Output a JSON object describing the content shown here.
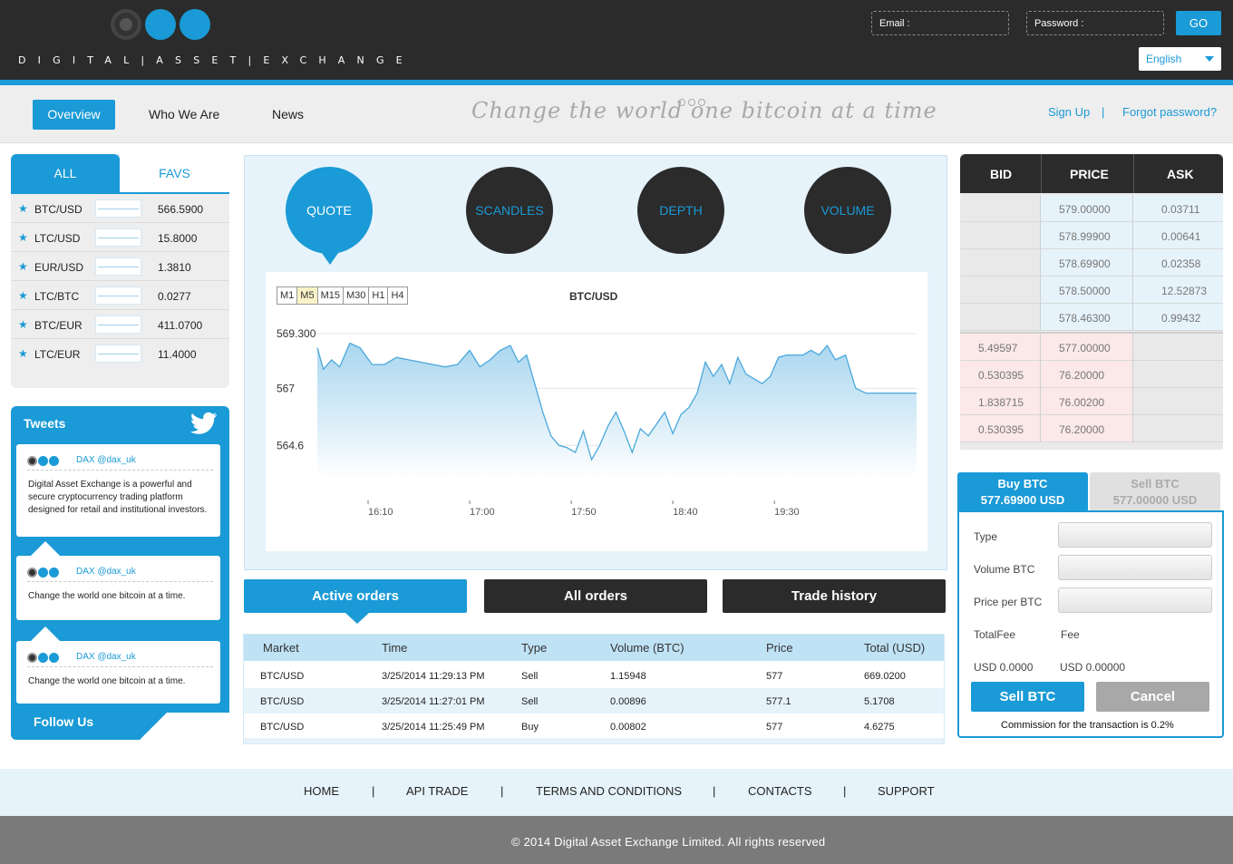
{
  "header": {
    "logo_text": "DIGITAL|ASSET|EXCHANGE",
    "email_placeholder": "Email :",
    "password_placeholder": "Password :",
    "go_label": "GO",
    "language": "English"
  },
  "nav": {
    "items": [
      {
        "label": "Overview"
      },
      {
        "label": "Who We Are"
      },
      {
        "label": "News"
      }
    ],
    "slogan": "Change the world one bitcoin at a time",
    "sign_up": "Sign Up",
    "separator": "|",
    "forgot_password": "Forgot password?"
  },
  "markets": {
    "tabs": [
      "ALL",
      "FAVS"
    ],
    "rows": [
      {
        "pair": "BTC/USD",
        "price": "566.5900"
      },
      {
        "pair": "LTC/USD",
        "price": "15.8000"
      },
      {
        "pair": "EUR/USD",
        "price": "1.3810"
      },
      {
        "pair": "LTC/BTC",
        "price": "0.0277"
      },
      {
        "pair": "BTC/EUR",
        "price": "411.0700"
      },
      {
        "pair": "LTC/EUR",
        "price": "11.4000"
      }
    ]
  },
  "tweets": {
    "title": "Tweets",
    "items": [
      {
        "handle": "DAX @dax_uk",
        "text": "Digital Asset Exchange is a powerful and secure cryptocurrency trading platform designed for retail and institutional investors."
      },
      {
        "handle": "DAX @dax_uk",
        "text": "Change the world one bitcoin at a time."
      },
      {
        "handle": "DAX @dax_uk",
        "text": "Change the world one bitcoin at a time."
      }
    ],
    "follow_us": "Follow Us"
  },
  "chart_panel": {
    "buttons": [
      "QUOTE",
      "SCANDLES",
      "DEPTH",
      "VOLUME"
    ],
    "timeframes": [
      "M1",
      "M5",
      "M15",
      "M30",
      "H1",
      "H4"
    ],
    "active_timeframe": "M5"
  },
  "chart_data": {
    "type": "area",
    "title": "BTC/USD",
    "xlabel": "",
    "ylabel": "",
    "ytick_labels": [
      "569.300",
      "567",
      "564.6"
    ],
    "ylim": [
      563.2,
      569.3
    ],
    "xtick_labels": [
      "16:10",
      "17:00",
      "17:50",
      "18:40",
      "19:30"
    ],
    "x": [
      "15:45",
      "15:48",
      "15:52",
      "15:56",
      "16:01",
      "16:06",
      "16:12",
      "16:18",
      "16:24",
      "16:30",
      "16:36",
      "16:42",
      "16:48",
      "16:54",
      "17:00",
      "17:05",
      "17:10",
      "17:15",
      "17:20",
      "17:24",
      "17:28",
      "17:32",
      "17:36",
      "17:40",
      "17:44",
      "17:48",
      "17:52",
      "17:56",
      "18:00",
      "18:04",
      "18:08",
      "18:12",
      "18:16",
      "18:20",
      "18:24",
      "18:28",
      "18:32",
      "18:36",
      "18:40",
      "18:44",
      "18:48",
      "18:52",
      "18:56",
      "19:00",
      "19:04",
      "19:08",
      "19:12",
      "19:16",
      "19:20",
      "19:24",
      "19:28",
      "19:32",
      "19:36",
      "19:40",
      "19:44",
      "19:48",
      "19:52",
      "19:56",
      "20:00",
      "20:05",
      "20:10",
      "20:15",
      "20:20",
      "20:25",
      "20:30",
      "20:35",
      "20:40"
    ],
    "series": [
      {
        "values": [
          568.7,
          567.8,
          568.2,
          567.9,
          568.9,
          568.7,
          568.0,
          568.0,
          568.3,
          568.2,
          568.1,
          568.0,
          567.9,
          568.0,
          568.6,
          567.9,
          568.2,
          568.6,
          568.8,
          568.1,
          568.4,
          567.2,
          566.0,
          565.0,
          564.6,
          564.5,
          564.3,
          565.2,
          564.0,
          564.6,
          565.4,
          566.0,
          565.2,
          564.3,
          565.3,
          565.0,
          565.5,
          566.0,
          565.1,
          565.9,
          566.2,
          566.8,
          568.1,
          567.5,
          568.0,
          567.2,
          568.3,
          567.6,
          567.4,
          567.2,
          567.5,
          568.3,
          568.4,
          568.4,
          568.4,
          568.6,
          568.4,
          568.8,
          568.2,
          568.4,
          567.0,
          566.8,
          566.8,
          566.8,
          566.8,
          566.8,
          566.8
        ]
      }
    ]
  },
  "order_tabs": [
    "Active orders",
    "All orders",
    "Trade history"
  ],
  "orders": {
    "headers": [
      "Market",
      "Time",
      "Type",
      "Volume (BTC)",
      "Price",
      "Total (USD)"
    ],
    "rows": [
      [
        "BTC/USD",
        "3/25/2014 11:29:13 PM",
        "Sell",
        "1.15948",
        "577",
        "669.0200"
      ],
      [
        "BTC/USD",
        "3/25/2014 11:27:01 PM",
        "Sell",
        "0.00896",
        "577.1",
        "5.1708"
      ],
      [
        "BTC/USD",
        "3/25/2014 11:25:49 PM",
        "Buy",
        "0.00802",
        "577",
        "4.6275"
      ]
    ]
  },
  "order_book": {
    "headers": [
      "BID",
      "PRICE",
      "ASK"
    ],
    "asks": [
      {
        "bid": "",
        "price": "579.00000",
        "ask": "0.03711"
      },
      {
        "bid": "",
        "price": "578.99900",
        "ask": "0.00641"
      },
      {
        "bid": "",
        "price": "578.69900",
        "ask": "0.02358"
      },
      {
        "bid": "",
        "price": "578.50000",
        "ask": "12.52873"
      },
      {
        "bid": "",
        "price": "578.46300",
        "ask": "0.99432"
      }
    ],
    "bids": [
      {
        "bid": "5.49597",
        "price": "577.00000",
        "ask": ""
      },
      {
        "bid": "0.530395",
        "price": "76.20000",
        "ask": ""
      },
      {
        "bid": "1.838715",
        "price": "76.00200",
        "ask": ""
      },
      {
        "bid": "0.530395",
        "price": "76.20000",
        "ask": ""
      }
    ]
  },
  "trade_form": {
    "buy_tab": {
      "title": "Buy BTC",
      "price": "577.69900 USD"
    },
    "sell_tab": {
      "title": "Sell BTC",
      "price": "577.00000 USD"
    },
    "type_label": "Type",
    "volume_label": "Volume BTC",
    "price_label": "Price per BTC",
    "total_fee_label": "TotalFee",
    "fee_label": "Fee",
    "total_value": "USD 0.0000",
    "fee_value": "USD 0.00000",
    "sell_button": "Sell BTC",
    "cancel_button": "Cancel",
    "commission": "Commission for the transaction is 0.2%"
  },
  "footer": {
    "links": [
      "HOME",
      "API TRADE",
      "TERMS AND CONDITIONS",
      "CONTACTS",
      "SUPPORT"
    ],
    "separator": "|",
    "copyright": "© 2014 Digital Asset Exchange Limited. All rights reserved"
  }
}
